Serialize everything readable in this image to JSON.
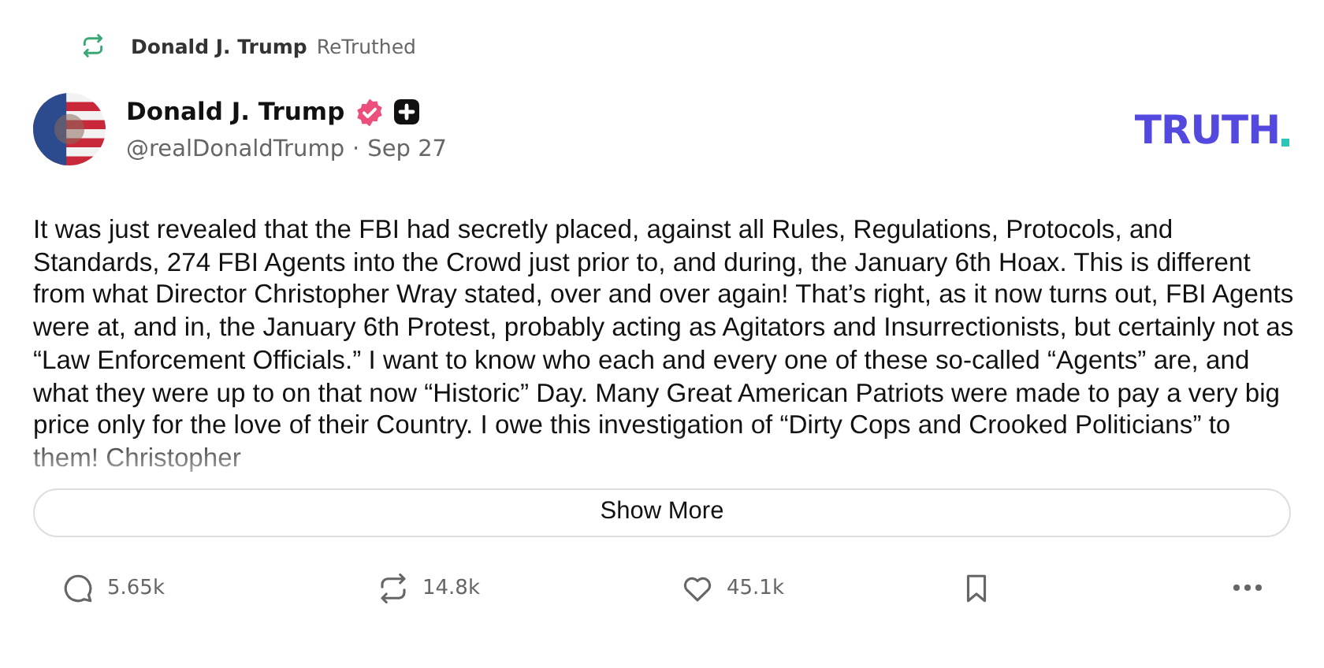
{
  "retruth": {
    "name": "Donald J. Trump",
    "label": "ReTruthed"
  },
  "post": {
    "author": "Donald J. Trump",
    "verified": true,
    "handle": "@realDonaldTrump",
    "separator": "·",
    "date": "Sep 27",
    "body": "It was just revealed that the FBI had secretly placed, against all Rules, Regulations, Protocols, and Standards, 274 FBI Agents into the Crowd just prior to, and during, the January 6th Hoax. This is different from what Director Christopher Wray stated, over and over again! That’s right, as it now turns out, FBI Agents were at, and in, the January 6th Protest, probably acting as Agitators and Insurrectionists, but certainly not as “Law Enforcement Officials.” I want to know who each and every one of these so-called “Agents” are, and what they were up to on that now “Historic” Day. Many Great American Patriots were made to pay a very big price only for the love of their Country. I owe this investigation of “Dirty Cops and Crooked Politicians” to them! Christopher"
  },
  "logo": "TRUTH",
  "show_more": "Show More",
  "actions": [
    {
      "kind": "reply",
      "count": "5.65k"
    },
    {
      "kind": "retruth",
      "count": "14.8k"
    },
    {
      "kind": "like",
      "count": "45.1k"
    },
    {
      "kind": "bookmark"
    },
    {
      "kind": "more"
    }
  ]
}
